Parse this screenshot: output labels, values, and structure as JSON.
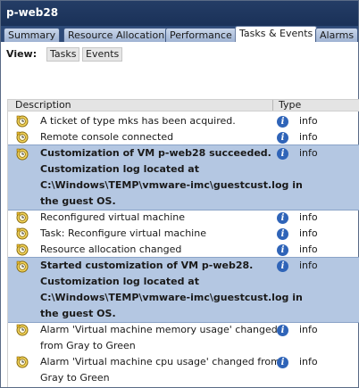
{
  "window": {
    "title": "p-web28"
  },
  "tabs": [
    {
      "label": "Summary",
      "active": false
    },
    {
      "label": "Resource Allocation",
      "active": false
    },
    {
      "label": "Performance",
      "active": false
    },
    {
      "label": "Tasks & Events",
      "active": true
    },
    {
      "label": "Alarms",
      "active": false
    }
  ],
  "view": {
    "label": "View:",
    "tasks_label": "Tasks",
    "events_label": "Events"
  },
  "columns": {
    "description": "Description",
    "type": "Type"
  },
  "events": [
    {
      "lines": [
        "A ticket of type mks has been acquired."
      ],
      "type": "info",
      "selected": false,
      "icon": "event-icon"
    },
    {
      "lines": [
        "Remote console connected"
      ],
      "type": "info",
      "selected": false,
      "icon": "event-icon"
    },
    {
      "lines": [
        "Customization of VM p-web28 succeeded.",
        "Customization log located at",
        "C:\\Windows\\TEMP\\vmware-imc\\guestcust.log in",
        "the guest OS."
      ],
      "type": "info",
      "selected": true,
      "icon": "event-icon"
    },
    {
      "lines": [
        "Reconfigured virtual machine"
      ],
      "type": "info",
      "selected": false,
      "icon": "event-icon"
    },
    {
      "lines": [
        "Task: Reconfigure virtual machine"
      ],
      "type": "info",
      "selected": false,
      "icon": "event-icon"
    },
    {
      "lines": [
        "Resource allocation changed"
      ],
      "type": "info",
      "selected": false,
      "icon": "event-icon"
    },
    {
      "lines": [
        "Started customization of VM p-web28.",
        "Customization log located at",
        "C:\\Windows\\TEMP\\vmware-imc\\guestcust.log in",
        "the guest OS."
      ],
      "type": "info",
      "selected": true,
      "icon": "event-icon"
    },
    {
      "lines": [
        "Alarm 'Virtual machine memory usage' changed",
        "from Gray to Green"
      ],
      "type": "info",
      "selected": false,
      "icon": "alarm-event-icon"
    },
    {
      "lines": [
        "Alarm 'Virtual machine cpu usage' changed from",
        "Gray to Green"
      ],
      "type": "info",
      "selected": false,
      "icon": "alarm-event-icon"
    }
  ],
  "colors": {
    "titlebar": "#1f3760",
    "selection": "#b4c7e2",
    "info_icon": "#2f64b8"
  }
}
